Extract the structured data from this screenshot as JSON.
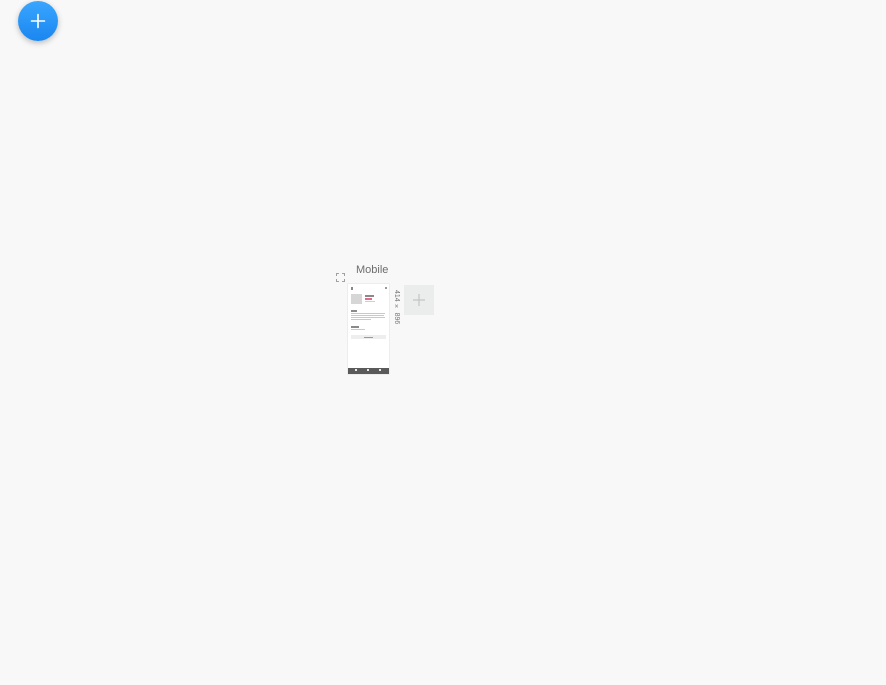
{
  "toolbar": {
    "add_button_icon": "plus-icon",
    "accent_color": "#2196f3"
  },
  "frame": {
    "title": "Mobile",
    "dimensions": "414 × 896",
    "expand_icon": "expand-icon",
    "add_frame_icon": "plus-icon"
  }
}
